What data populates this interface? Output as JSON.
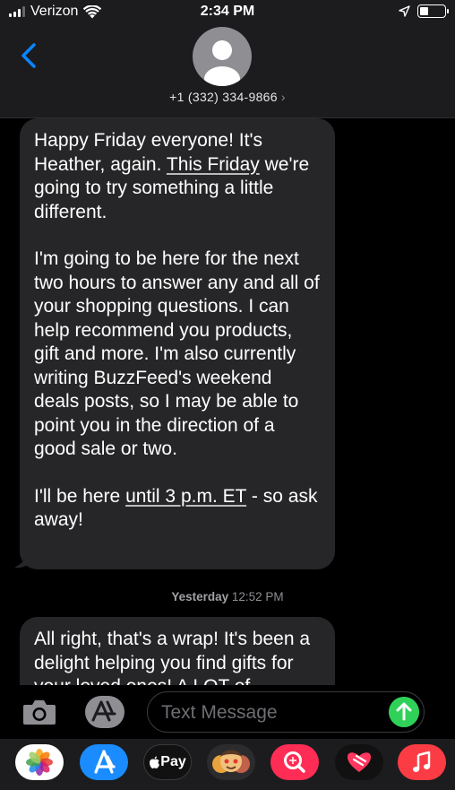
{
  "status_bar": {
    "carrier": "Verizon",
    "time": "2:34 PM"
  },
  "header": {
    "contact_number": "+1 (332) 334-9866",
    "chevron": "›"
  },
  "messages": [
    {
      "paragraphs": [
        [
          {
            "text": "Happy Friday everyone! It's Heather, again. "
          },
          {
            "text": "This Friday",
            "underline": true
          },
          {
            "text": " we're going to try something a little different."
          }
        ],
        [
          {
            "text": "I'm going to be here for the next two hours to answer any and all of your shopping questions. I can help recommend you products, gift and more. I'm also currently writing BuzzFeed's weekend deals posts, so I may be able to point you in the direction of a good sale or two."
          }
        ],
        [
          {
            "text": "I'll be here "
          },
          {
            "text": "until 3 p.m. ET",
            "underline": true
          },
          {
            "text": " - so ask away!"
          }
        ]
      ]
    },
    {
      "paragraphs": [
        [
          {
            "text": "All right, that's a wrap! It's been a delight helping you find gifts for your loved ones! A LOT of"
          }
        ]
      ]
    }
  ],
  "timestamp": {
    "day": "Yesterday",
    "time": "12:52 PM"
  },
  "compose": {
    "placeholder": "Text Message"
  },
  "app_drawer": {
    "apple_pay_label": "Pay",
    "apps": [
      "photos-icon",
      "app-store-icon",
      "apple-pay-icon",
      "memoji-icon",
      "search-images-icon",
      "digital-touch-icon",
      "music-icon"
    ]
  },
  "colors": {
    "bubble": "#262628",
    "accent_blue": "#0a84ff",
    "send_green": "#30d158",
    "bar_background": "#1c1c1e"
  }
}
